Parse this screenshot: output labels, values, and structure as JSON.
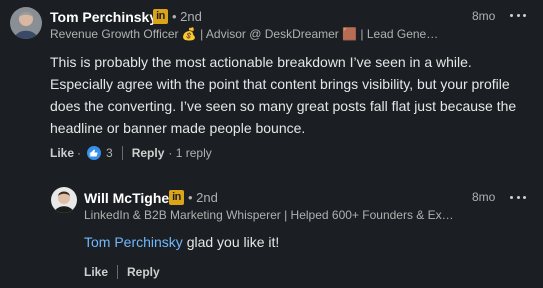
{
  "comment": {
    "author": "Tom Perchinsky",
    "badge": "in",
    "degree": "• 2nd",
    "headline": "Revenue Growth Officer 💰 | Advisor @ DeskDreamer 🟫 | Lead Generatio...",
    "time": "8mo",
    "text": "This is probably the most actionable breakdown I’ve seen in a while. Especially agree with the point that content brings visibility, but your profile does the converting. I’ve seen so many great posts fall flat just because the headline or banner made people bounce.",
    "like_label": "Like",
    "dot": "·",
    "like_count": "3",
    "reply_label": "Reply",
    "reply_count": "· 1 reply"
  },
  "reply": {
    "author": "Will McTighe",
    "badge": "in",
    "degree": "• 2nd",
    "headline": "LinkedIn & B2B Marketing Whisperer | Helped 600+ Founders & Exe...",
    "time": "8mo",
    "mention": "Tom Perchinsky",
    "text": " glad you like it!",
    "like_label": "Like",
    "reply_label": "Reply"
  },
  "colors": {
    "background": "#1b1f23",
    "link": "#71b7fb",
    "badge": "#dba418",
    "reaction": "#378fe9"
  },
  "icons": [
    "more-options-icon",
    "linkedin-premium-icon",
    "like-reaction-icon"
  ]
}
